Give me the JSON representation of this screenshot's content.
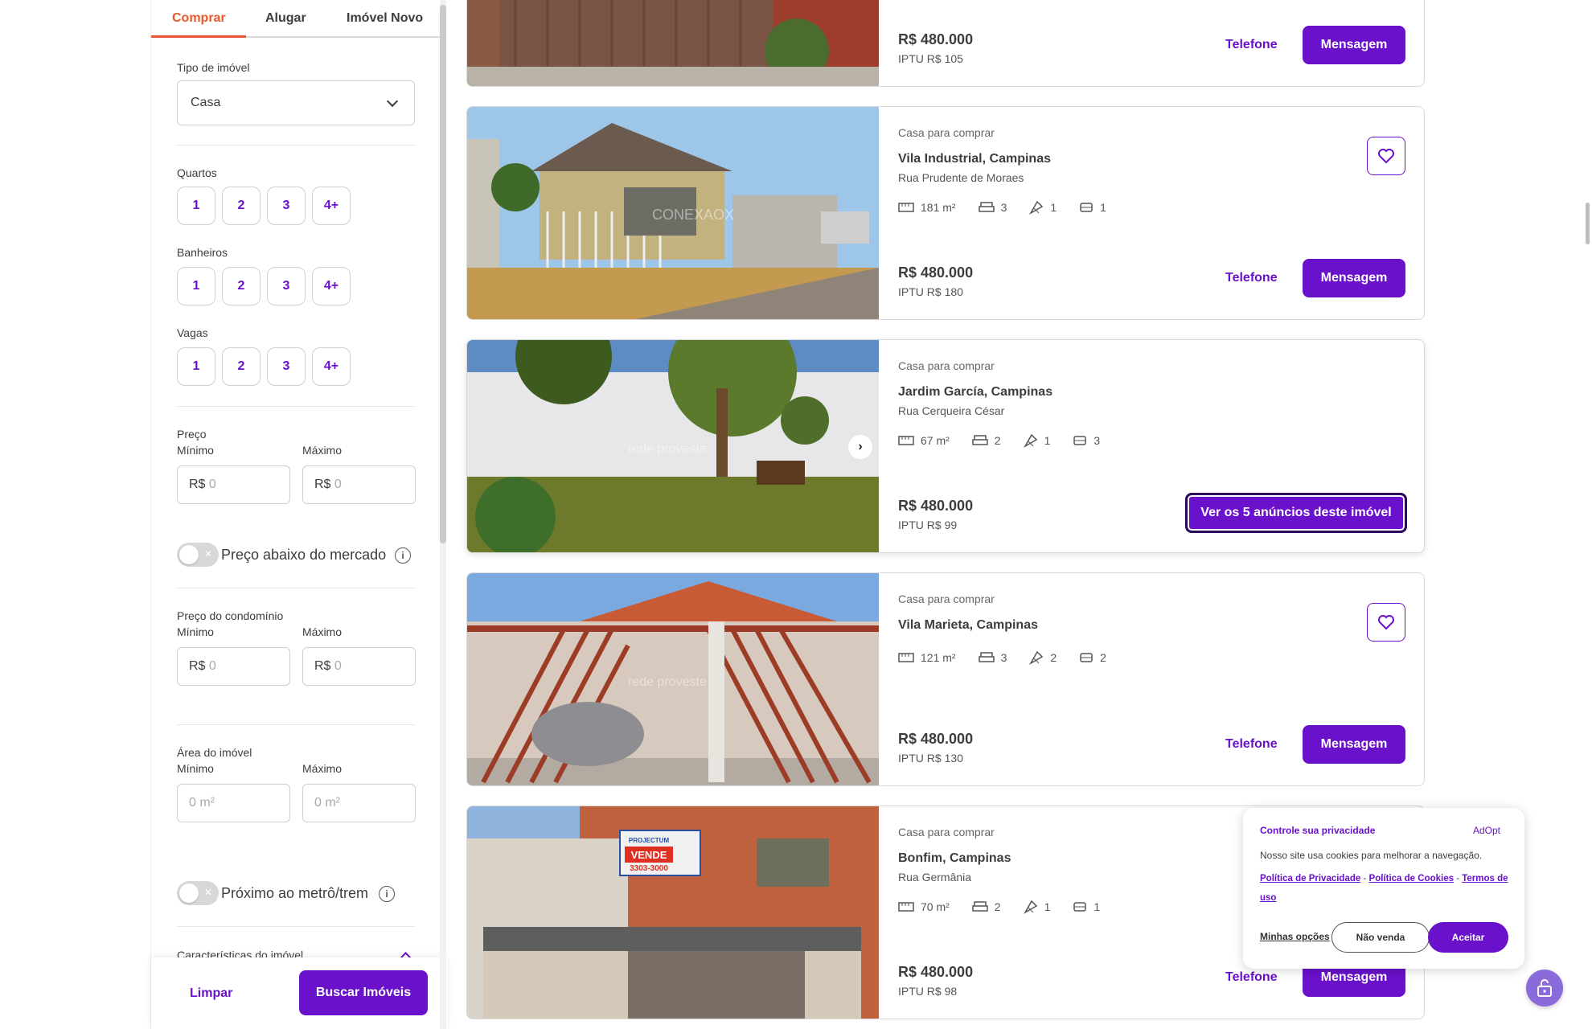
{
  "filters": {
    "tabs": [
      "Comprar",
      "Alugar",
      "Imóvel Novo"
    ],
    "property_type_label": "Tipo de imóvel",
    "property_type_value": "Casa",
    "bedrooms_label": "Quartos",
    "bathrooms_label": "Banheiros",
    "parking_label": "Vagas",
    "count_options": [
      "1",
      "2",
      "3",
      "4+"
    ],
    "price_label": "Preço",
    "min_label": "Mínimo",
    "max_label": "Máximo",
    "currency": "R$",
    "price_placeholder": "0",
    "below_market_label": "Preço abaixo do mercado",
    "condo_price_label": "Preço do condomínio",
    "area_label": "Área do imóvel",
    "area_placeholder": "0 m²",
    "near_metro_label": "Próximo ao metrô/trem",
    "features_label": "Características do imóvel",
    "clear_label": "Limpar",
    "search_label": "Buscar Imóveis"
  },
  "listings": [
    {
      "type": "",
      "neighborhood": "",
      "street": "",
      "area": "",
      "bedrooms": "",
      "bathrooms": "",
      "parking": "",
      "price": "R$ 480.000",
      "iptu": "IPTU R$ 105",
      "phone_label": "Telefone",
      "message_label": "Mensagem"
    },
    {
      "type": "Casa para comprar",
      "neighborhood": "Vila Industrial, Campinas",
      "street": "Rua Prudente de Moraes",
      "area": "181 m²",
      "bedrooms": "3",
      "bathrooms": "1",
      "parking": "1",
      "price": "R$ 480.000",
      "iptu": "IPTU R$ 180",
      "phone_label": "Telefone",
      "message_label": "Mensagem",
      "watermark": "CONEXAOX"
    },
    {
      "type": "Casa para comprar",
      "neighborhood": "Jardim García, Campinas",
      "street": "Rua Cerqueira César",
      "area": "67 m²",
      "bedrooms": "2",
      "bathrooms": "1",
      "parking": "3",
      "price": "R$ 480.000",
      "iptu": "IPTU R$ 99",
      "more_label": "Ver os 5 anúncios deste imóvel",
      "watermark": "rede proveste"
    },
    {
      "type": "Casa para comprar",
      "neighborhood": "Vila Marieta, Campinas",
      "street": "",
      "area": "121 m²",
      "bedrooms": "3",
      "bathrooms": "2",
      "parking": "2",
      "price": "R$ 480.000",
      "iptu": "IPTU R$ 130",
      "phone_label": "Telefone",
      "message_label": "Mensagem",
      "watermark": "rede proveste"
    },
    {
      "type": "Casa para comprar",
      "neighborhood": "Bonfim, Campinas",
      "street": "Rua Germânia",
      "area": "70 m²",
      "bedrooms": "2",
      "bathrooms": "1",
      "parking": "1",
      "price": "R$ 480.000",
      "iptu": "IPTU R$ 98",
      "phone_label": "Telefone",
      "message_label": "Mensagem",
      "sign_brand": "PROJECTUM",
      "sign_text": "VENDE",
      "sign_phone": "3303-3000"
    }
  ],
  "cookie": {
    "title": "Controle sua privacidade",
    "brand": "AdOpt",
    "description": "Nosso site usa cookies para melhorar a navegação.",
    "privacy_link": "Política de Privacidade",
    "cookies_link": "Política de Cookies",
    "terms_link": "Termos de uso",
    "separator": "-",
    "options_label": "Minhas opções",
    "no_sale_label": "Não venda",
    "accept_label": "Aceitar"
  },
  "colors": {
    "accent": "#6a11cb",
    "active_tab": "#e8582a"
  },
  "icons": [
    "chevron-down-icon",
    "info-icon",
    "area-icon",
    "bed-icon",
    "shower-icon",
    "car-icon",
    "heart-icon",
    "chevron-right-icon",
    "lock-icon"
  ]
}
